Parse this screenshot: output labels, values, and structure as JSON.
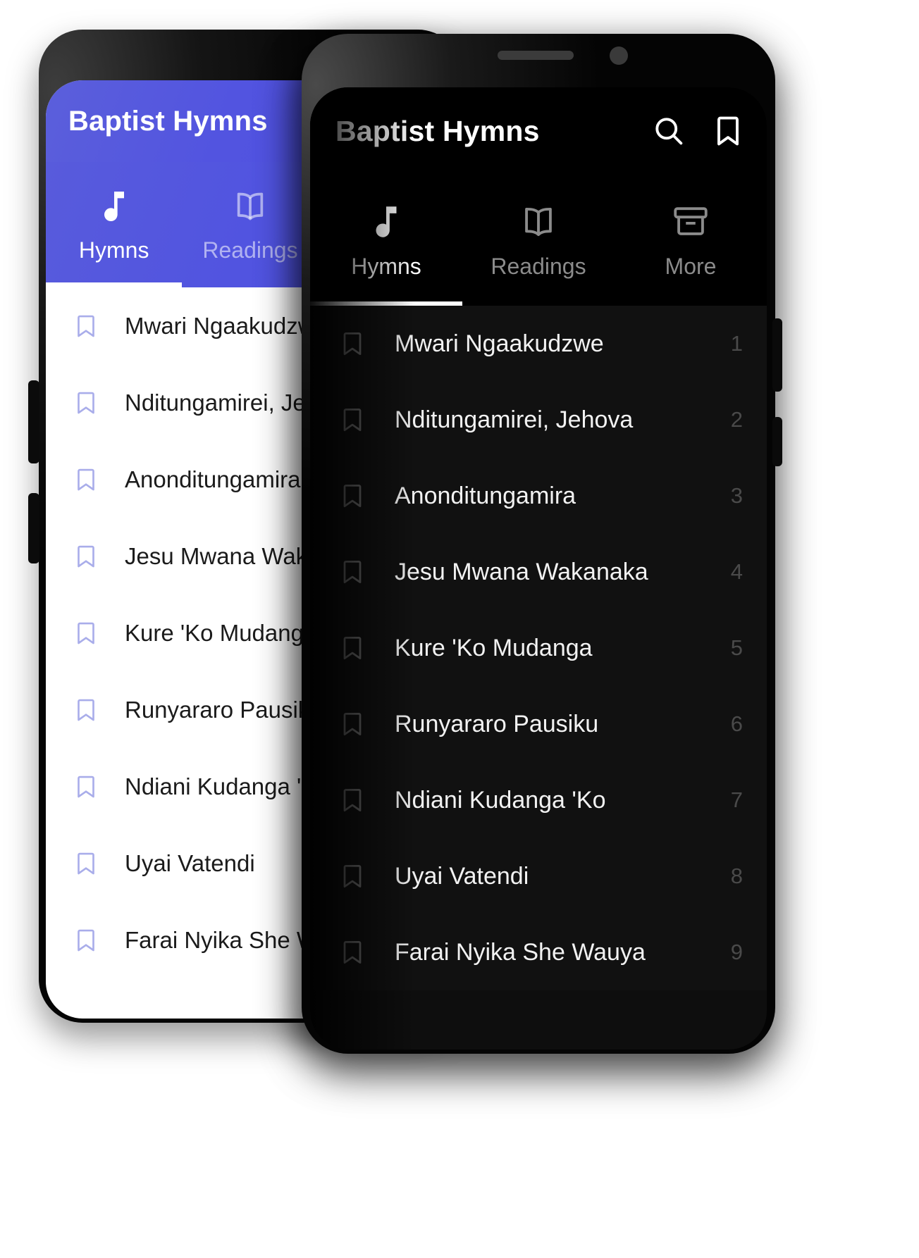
{
  "app": {
    "title": "Baptist Hymns",
    "actions": [
      {
        "name": "search",
        "icon": "search-icon",
        "label": "Search"
      },
      {
        "name": "bookmarks",
        "icon": "bookmark-icon",
        "label": "Bookmarks"
      }
    ],
    "tabs": [
      {
        "label": "Hymns",
        "icon": "music-note-icon",
        "active": true
      },
      {
        "label": "Readings",
        "icon": "open-book-icon",
        "active": false
      },
      {
        "label": "More",
        "icon": "archive-icon",
        "active": false
      }
    ],
    "hymns": [
      {
        "number": "1",
        "title": "Mwari Ngaakudzwe"
      },
      {
        "number": "2",
        "title": "Nditungamirei, Jehova"
      },
      {
        "number": "3",
        "title": "Anonditungamira"
      },
      {
        "number": "4",
        "title": "Jesu Mwana Wakanaka"
      },
      {
        "number": "5",
        "title": "Kure 'Ko Mudanga"
      },
      {
        "number": "6",
        "title": "Runyararo Pausiku"
      },
      {
        "number": "7",
        "title": "Ndiani Kudanga 'Ko"
      },
      {
        "number": "8",
        "title": "Uyai Vatendi"
      },
      {
        "number": "9",
        "title": "Farai Nyika She Wauya"
      }
    ]
  },
  "devices": {
    "light": {
      "theme": "light",
      "accent": "#5154e0",
      "background": "#ffffff",
      "text": "#1b1b1b"
    },
    "dark": {
      "theme": "dark",
      "accent": "#000000",
      "background": "#111111",
      "text": "#f2f2f2"
    }
  }
}
